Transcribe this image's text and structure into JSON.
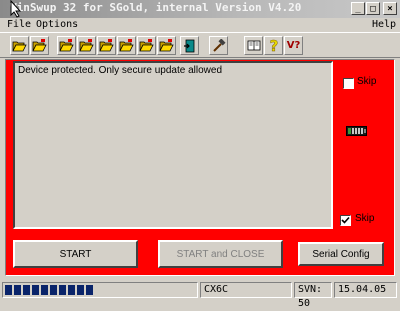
{
  "window": {
    "title": "WinSwup 32 for SGold, internal Version V4.20",
    "minimize": "_",
    "maximize": "□",
    "close": "×"
  },
  "menu": {
    "file": "File",
    "options": "Options",
    "help": "Help"
  },
  "toolbar": {
    "icons": [
      "folder-open-icon",
      "folder-open-icon",
      "folder-open-icon",
      "folder-open-icon",
      "folder-open-icon",
      "folder-open-icon",
      "folder-open-icon",
      "exit-icon",
      "hammer-icon",
      "book-icon",
      "question-icon",
      "version-check-icon"
    ],
    "version_label": "V?"
  },
  "log": {
    "text": "Device protected. Only secure update allowed"
  },
  "options": {
    "skip_top": {
      "label": "Skip",
      "checked": false
    },
    "skip_bottom": {
      "label": "Skip",
      "checked": true
    }
  },
  "buttons": {
    "start": "START",
    "start_close": "START and CLOSE",
    "serial_config": "Serial Config"
  },
  "status": {
    "progress": 0.48,
    "model": "CX6C",
    "svn": "SVN: 50",
    "date": "15.04.05"
  },
  "colors": {
    "panel": "#ff0000",
    "progress": "#0a246a"
  }
}
